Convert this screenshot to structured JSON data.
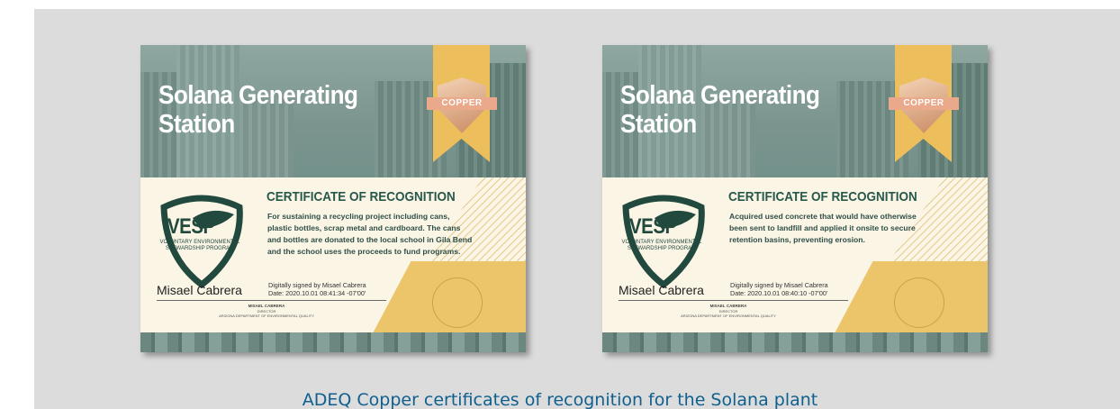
{
  "caption": "ADEQ Copper certificates of recognition for the Solana plant",
  "certificates": [
    {
      "site_title": "Solana Generating Station",
      "badge_label": "COPPER",
      "program_short": "VESP",
      "program_full": "VOLUNTARY ENVIRONMENTAL STEWARDSHIP PROGRAM",
      "heading": "CERTIFICATE OF RECOGNITION",
      "body": "For sustaining a recycling project including cans, plastic bottles, scrap metal and cardboard. The cans and bottles are donated to the local school in Gila Bend and the school uses the proceeds to fund programs.",
      "signer_name": "Misael Cabrera",
      "digital_signature_line1": "Digitally signed by Misael Cabrera",
      "digital_signature_line2": "Date: 2020.10.01 08:41:34 -07'00'",
      "signer_caps": "MISAEL CABRERA",
      "signer_role": "DIRECTOR",
      "signer_dept": "ARIZONA DEPARTMENT OF ENVIRONMENTAL QUALITY"
    },
    {
      "site_title": "Solana Generating Station",
      "badge_label": "COPPER",
      "program_short": "VESP",
      "program_full": "VOLUNTARY ENVIRONMENTAL STEWARDSHIP PROGRAM",
      "heading": "CERTIFICATE OF RECOGNITION",
      "body": "Acquired used concrete that would have otherwise been sent to landfill and applied it onsite to secure retention basins, preventing erosion.",
      "signer_name": "Misael Cabrera",
      "digital_signature_line1": "Digitally signed by Misael Cabrera",
      "digital_signature_line2": "Date: 2020.10.01 08:40:10 -07'00'",
      "signer_caps": "MISAEL CABRERA",
      "signer_role": "DIRECTOR",
      "signer_dept": "ARIZONA DEPARTMENT OF ENVIRONMENTAL QUALITY"
    }
  ],
  "colors": {
    "teal": "#7b958e",
    "gold": "#edbf5c",
    "dark_green": "#22493e",
    "caption_blue": "#0f5f8f"
  }
}
